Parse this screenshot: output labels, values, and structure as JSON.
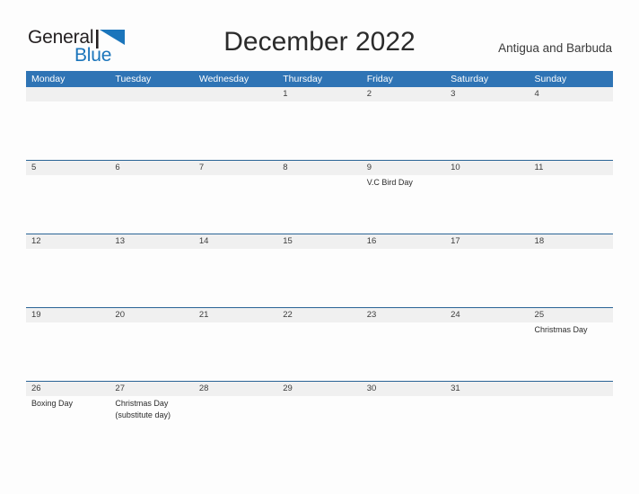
{
  "brand": {
    "name_part1": "General",
    "name_part2": "Blue",
    "flag_icon": "blue-flag-triangle",
    "color_blue": "#1b75bb",
    "color_dark": "#231f20"
  },
  "header": {
    "title": "December 2022",
    "country": "Antigua and Barbuda"
  },
  "theme": {
    "header_blue": "#2f74b5",
    "row_divider_blue": "#2a6496",
    "day_band_gray": "#f0f0f0",
    "page_background": "#fdfdfd"
  },
  "weekdays": [
    {
      "label": "Monday"
    },
    {
      "label": "Tuesday"
    },
    {
      "label": "Wednesday"
    },
    {
      "label": "Thursday"
    },
    {
      "label": "Friday"
    },
    {
      "label": "Saturday"
    },
    {
      "label": "Sunday"
    }
  ],
  "weeks": [
    {
      "days": [
        {
          "date": "",
          "event": ""
        },
        {
          "date": "",
          "event": ""
        },
        {
          "date": "",
          "event": ""
        },
        {
          "date": "1",
          "event": ""
        },
        {
          "date": "2",
          "event": ""
        },
        {
          "date": "3",
          "event": ""
        },
        {
          "date": "4",
          "event": ""
        }
      ]
    },
    {
      "days": [
        {
          "date": "5",
          "event": ""
        },
        {
          "date": "6",
          "event": ""
        },
        {
          "date": "7",
          "event": ""
        },
        {
          "date": "8",
          "event": ""
        },
        {
          "date": "9",
          "event": "V.C Bird Day"
        },
        {
          "date": "10",
          "event": ""
        },
        {
          "date": "11",
          "event": ""
        }
      ]
    },
    {
      "days": [
        {
          "date": "12",
          "event": ""
        },
        {
          "date": "13",
          "event": ""
        },
        {
          "date": "14",
          "event": ""
        },
        {
          "date": "15",
          "event": ""
        },
        {
          "date": "16",
          "event": ""
        },
        {
          "date": "17",
          "event": ""
        },
        {
          "date": "18",
          "event": ""
        }
      ]
    },
    {
      "days": [
        {
          "date": "19",
          "event": ""
        },
        {
          "date": "20",
          "event": ""
        },
        {
          "date": "21",
          "event": ""
        },
        {
          "date": "22",
          "event": ""
        },
        {
          "date": "23",
          "event": ""
        },
        {
          "date": "24",
          "event": ""
        },
        {
          "date": "25",
          "event": "Christmas Day"
        }
      ]
    },
    {
      "days": [
        {
          "date": "26",
          "event": "Boxing Day"
        },
        {
          "date": "27",
          "event": "Christmas Day\n(substitute day)"
        },
        {
          "date": "28",
          "event": ""
        },
        {
          "date": "29",
          "event": ""
        },
        {
          "date": "30",
          "event": ""
        },
        {
          "date": "31",
          "event": ""
        },
        {
          "date": "",
          "event": ""
        }
      ]
    }
  ]
}
